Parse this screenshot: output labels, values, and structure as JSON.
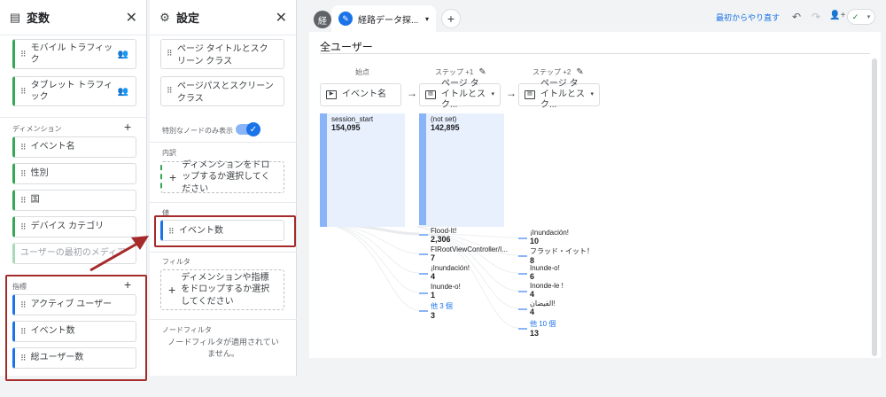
{
  "variables_panel": {
    "title": "変数",
    "segments": [
      {
        "label": "モバイル トラフィック"
      },
      {
        "label": "タブレット トラフィック"
      }
    ],
    "dimensions_label": "ディメンション",
    "dimensions": [
      {
        "label": "イベント名"
      },
      {
        "label": "性別"
      },
      {
        "label": "国"
      },
      {
        "label": "デバイス カテゴリ"
      },
      {
        "label": "ユーザーの最初のメディア"
      }
    ],
    "metrics_label": "指標",
    "metrics": [
      {
        "label": "アクティブ ユーザー"
      },
      {
        "label": "イベント数"
      },
      {
        "label": "総ユーザー数"
      }
    ]
  },
  "settings_panel": {
    "title": "設定",
    "segments": [
      {
        "label": "ページ タイトルとスクリーン クラス"
      },
      {
        "label": "ページパスとスクリーン クラス"
      }
    ],
    "toggle_label": "特別なノードのみ表示",
    "breakdown_label": "内訳",
    "breakdown_drop": "ディメンションをドロップするか選択してください",
    "values_label": "値",
    "value_chip": "イベント数",
    "filter_label": "フィルタ",
    "filter_drop": "ディメンションや指標をドロップするか選択してください",
    "node_filter_label": "ノードフィルタ",
    "node_filter_note": "ノードフィルタが適用されていません。"
  },
  "topbar": {
    "home_tab_glyph": "経",
    "active_tab_label": "経路データ探...",
    "reset_label": "最初からやり直す"
  },
  "canvas": {
    "segment_title": "全ユーザー",
    "columns": [
      {
        "step_label": "始点",
        "node": "イベント名"
      },
      {
        "step_label": "ステップ +1",
        "node": "ページ タイトルとスク..."
      },
      {
        "step_label": "ステップ +2",
        "node": "ページ タイトルとスク..."
      }
    ],
    "start_node": {
      "label": "session_start",
      "value": "154,095"
    },
    "step1_main": {
      "label": "(not set)",
      "value": "142,895"
    },
    "step1_nodes": [
      {
        "label": "Flood-It!",
        "value": "2,306"
      },
      {
        "label": "FIRootViewController/I...",
        "value": "7"
      },
      {
        "label": "¡Inundación!",
        "value": "4"
      },
      {
        "label": "Inunde-o!",
        "value": "1"
      },
      {
        "label": "他 3 個",
        "value": "3"
      }
    ],
    "step2_nodes": [
      {
        "label": "¡Inundación!",
        "value": "10"
      },
      {
        "label": "フラッド・イット！",
        "value": "8"
      },
      {
        "label": "Inunde-o!",
        "value": "6"
      },
      {
        "label": "Inonde-le !",
        "value": "4"
      },
      {
        "label": "الفيضان!",
        "value": "4"
      },
      {
        "label": "他 10 個",
        "value": "13"
      }
    ]
  },
  "icons": {
    "close": "✕",
    "plus": "+",
    "grip": "⠿",
    "pen": "✎",
    "undo": "↶",
    "redo": "↷",
    "add_person": "👤+",
    "check": "✓",
    "caret": "▾",
    "arrow_right": "→"
  },
  "colors": {
    "accent": "#1a73e8",
    "dimension_edge": "#34a853",
    "metric_edge": "#1a73e8",
    "highlight_box": "#a52a2a",
    "node_bar": "#8ab4f8"
  }
}
